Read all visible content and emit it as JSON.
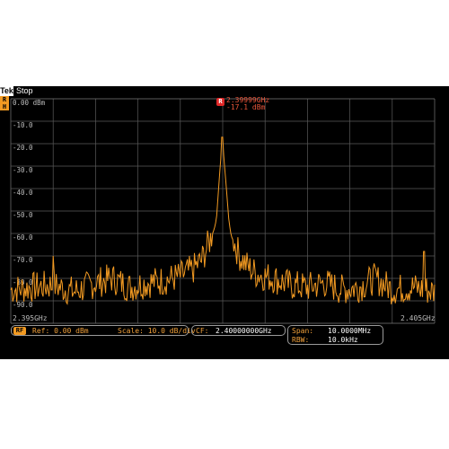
{
  "header": {
    "brand": "Tek",
    "status": "Stop"
  },
  "channel_badge": "R",
  "y_axis": {
    "unit": "dBm",
    "ticks": [
      "0.00 dBm",
      "-10.0",
      "-20.0",
      "-30.0",
      "-40.0",
      "-50.0",
      "-60.0",
      "-70.0",
      "-80.0",
      "-90.0"
    ]
  },
  "x_axis": {
    "start_label": "2.395GHz",
    "stop_label": "2.405GHz"
  },
  "marker": {
    "badge": "R",
    "frequency": "2.39999GHz",
    "level": "-17.1 dBm"
  },
  "settings": {
    "rf_badge": "RF",
    "ref": "Ref: 0.00 dBm",
    "scale": "Scale: 10.0 dB/div",
    "cf_label": "CF:",
    "cf_value": "2.40000000GHz",
    "span_label": "Span:",
    "span_value": "10.0000MHz",
    "rbw_label": "RBW:",
    "rbw_value": "10.0kHz"
  },
  "colors": {
    "trace": "#f29a22",
    "grid": "#5a5a5a",
    "background": "#000000",
    "marker": "#e02828"
  },
  "chart_data": {
    "type": "line",
    "title": "",
    "xlabel": "",
    "ylabel": "",
    "xlim": [
      2.395,
      2.405
    ],
    "ylim": [
      -100,
      0
    ],
    "grid": true,
    "series": [
      {
        "x": [
          2.395,
          2.3955,
          2.396,
          2.3965,
          2.397,
          2.3974,
          2.3978,
          2.3982,
          2.3986,
          2.399,
          2.3993,
          2.3995,
          2.3997,
          2.3998,
          2.39985,
          2.39999,
          2.40015,
          2.4002,
          2.4004,
          2.4006,
          2.4008,
          2.4012,
          2.4016,
          2.402,
          2.4024,
          2.4028,
          2.4032,
          2.4036,
          2.404,
          2.4045,
          2.405
        ],
        "values": [
          -85,
          -84,
          -83,
          -86,
          -82,
          -80,
          -84,
          -82,
          -81,
          -79,
          -76,
          -72,
          -63,
          -58,
          -54,
          -17.1,
          -55,
          -61,
          -70,
          -75,
          -78,
          -80,
          -83,
          -84,
          -82,
          -85,
          -84,
          -80,
          -85,
          -84,
          -86
        ]
      }
    ],
    "spurs": [
      {
        "x": 2.396,
        "y": -70
      },
      {
        "x": 2.40475,
        "y": -68
      }
    ]
  }
}
